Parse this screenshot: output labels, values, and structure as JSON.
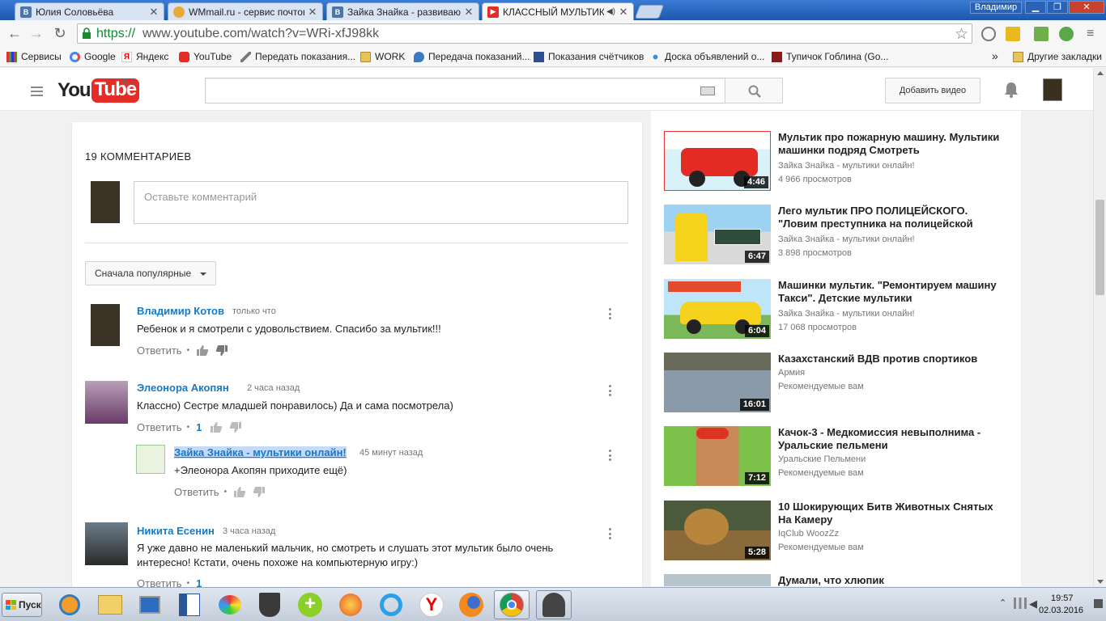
{
  "browser": {
    "tabs": [
      {
        "label": "Юлия Соловьёва",
        "icon": "vk-icon"
      },
      {
        "label": "WMmail.ru - сервис почтовы",
        "icon": "wmmail-icon"
      },
      {
        "label": "Зайка Знайка - развивающ",
        "icon": "vk-icon"
      },
      {
        "label": "КЛАССНЫЙ МУЛЬТИК ПР",
        "icon": "youtube-icon"
      }
    ],
    "window_user": "Владимир",
    "url_scheme": "https://",
    "url_rest": "www.youtube.com/watch?v=WRi-xfJ98kk",
    "bookmarks": [
      "Сервисы",
      "Google",
      "Яндекс",
      "YouTube",
      "Передать показания...",
      "WORK",
      "Передача показаний...",
      "Показания счётчиков",
      "Доска объявлений о...",
      "Тупичок Гоблина (Go..."
    ],
    "bookmarks_overflow": "»",
    "other_bookmarks": "Другие закладки"
  },
  "youtube": {
    "logo_you": "You",
    "logo_tube": "Tube",
    "logo_region": "RU",
    "upload_label": "Добавить видео"
  },
  "comments": {
    "count_label": "19 КОММЕНТАРИЕВ",
    "input_placeholder": "Оставьте комментарий",
    "sort_label": "Сначала популярные",
    "reply_label": "Ответить",
    "items": [
      {
        "author": "Владимир Котов",
        "time": "только что",
        "text": "Ребенок и я смотрели с удовольствием. Спасибо за мультик!!!",
        "likes": ""
      },
      {
        "author": "Элеонора Акопян",
        "time": "2 часа назад",
        "text": "Классно) Сестре младшей понравилось) Да и сама посмотрела)",
        "likes": "1"
      },
      {
        "author": "Зайка Знайка - мультики онлайн!",
        "time": "45 минут назад",
        "text": "+Элеонора Акопян приходите ещё)",
        "likes": ""
      },
      {
        "author": "Никита Есенин",
        "time": "3 часа назад",
        "text": "Я уже давно не маленький мальчик, но смотреть и слушать этот мультик было очень интересно! Кстати, очень похоже на компьютерную игру:)",
        "likes": "1"
      }
    ]
  },
  "sidebar": {
    "videos": [
      {
        "title": "Мультик про пожарную машину. Мультики машинки подряд Смотреть",
        "channel": "Зайка Знайка - мультики онлайн!",
        "meta": "4 966 просмотров",
        "duration": "4:46"
      },
      {
        "title": "Лего мультик ПРО ПОЛИЦЕЙСКОГО. \"Ловим преступника на полицейской",
        "channel": "Зайка Знайка - мультики онлайн!",
        "meta": "3 898 просмотров",
        "duration": "6:47"
      },
      {
        "title": "Машинки мультик. \"Ремонтируем машину Такси\". Детские мультики",
        "channel": "Зайка Знайка - мультики онлайн!",
        "meta": "17 068 просмотров",
        "duration": "6:04"
      },
      {
        "title": "Казахстанский ВДВ против спортиков",
        "channel": "Армия",
        "meta": "Рекомендуемые вам",
        "duration": "16:01"
      },
      {
        "title": "Качок-3 - Медкомиссия невыполнима - Уральские пельмени",
        "channel": "Уральские Пельмени",
        "meta": "Рекомендуемые вам",
        "duration": "7:12"
      },
      {
        "title": "10 Шокирующих Битв Животных Снятых На Камеру",
        "channel": "IqClub WoozZz",
        "meta": "Рекомендуемые вам",
        "duration": "5:28"
      },
      {
        "title": "Думали, что хлюпик",
        "channel": "",
        "meta": "",
        "duration": ""
      }
    ]
  },
  "taskbar": {
    "start_label": "Пуск",
    "time": "19:57",
    "date": "02.03.2016"
  }
}
